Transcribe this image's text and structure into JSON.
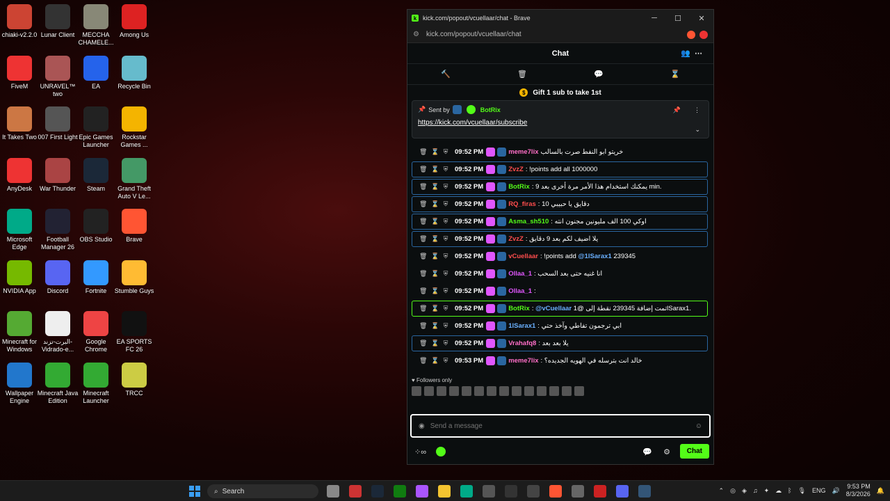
{
  "desktop_icons": [
    {
      "label": "chiaki-v2.2.0",
      "color": "#c43"
    },
    {
      "label": "Lunar Client",
      "color": "#333"
    },
    {
      "label": "MECCHA CHAMELE...",
      "color": "#887"
    },
    {
      "label": "Among Us",
      "color": "#d22"
    },
    {
      "label": "FiveM",
      "color": "#e33"
    },
    {
      "label": "UNRAVEL™ two",
      "color": "#a55"
    },
    {
      "label": "EA",
      "color": "#2563eb"
    },
    {
      "label": "Recycle Bin",
      "color": "#6bc"
    },
    {
      "label": "It Takes Two",
      "color": "#c74"
    },
    {
      "label": "007 First Light",
      "color": "#555"
    },
    {
      "label": "Epic Games Launcher",
      "color": "#222"
    },
    {
      "label": "Rockstar Games ...",
      "color": "#f4b400"
    },
    {
      "label": "AnyDesk",
      "color": "#e33"
    },
    {
      "label": "War Thunder",
      "color": "#a44"
    },
    {
      "label": "Steam",
      "color": "#1b2838"
    },
    {
      "label": "Grand Theft Auto V Le...",
      "color": "#496"
    },
    {
      "label": "Microsoft Edge",
      "color": "#0a8"
    },
    {
      "label": "Football Manager 26",
      "color": "#223"
    },
    {
      "label": "OBS Studio",
      "color": "#222"
    },
    {
      "label": "Brave",
      "color": "#f53"
    },
    {
      "label": "NVIDIA App",
      "color": "#76b900"
    },
    {
      "label": "Discord",
      "color": "#5865f2"
    },
    {
      "label": "Fortnite",
      "color": "#39f"
    },
    {
      "label": "Stumble Guys",
      "color": "#fb3"
    },
    {
      "label": "Minecraft for Windows",
      "color": "#5a3"
    },
    {
      "label": "البرت-تزند-Vidrado-e...",
      "color": "#eee"
    },
    {
      "label": "Google Chrome",
      "color": "#e44"
    },
    {
      "label": "EA SPORTS FC 26",
      "color": "#111"
    },
    {
      "label": "Wallpaper Engine",
      "color": "#27c"
    },
    {
      "label": "Minecraft Java Edition",
      "color": "#3a3"
    },
    {
      "label": "Minecraft Launcher",
      "color": "#3a3"
    },
    {
      "label": "TRCC",
      "color": "#cc4"
    }
  ],
  "window": {
    "title": "kick.com/popout/vcuellaar/chat - Brave",
    "url": "kick.com/popout/vcuellaar/chat",
    "chat_title": "Chat",
    "gift_text": "Gift 1 sub to take 1st",
    "pinned": {
      "sent_by": "Sent by",
      "sender": "BotRix",
      "link": "https://kick.com/vcuellaar/subscribe"
    },
    "followers_only": "Followers only",
    "input_placeholder": "Send a message",
    "chat_button": "Chat"
  },
  "messages": [
    {
      "time": "09:52 PM",
      "user": "meme7lix",
      "color": "#ff6ec7",
      "text": "خريتو ابو النفط صرت بالسالب",
      "hl": ""
    },
    {
      "time": "09:52 PM",
      "user": "ZvzZ",
      "color": "#ff4d4d",
      "text": ": !points add all 1000000",
      "hl": "hl"
    },
    {
      "time": "09:52 PM",
      "user": "BotRix",
      "color": "#53fc18",
      "text": ": يمكنك استخدام هذا الأمر مرة أخرى بعد 9 min.",
      "hl": "hl"
    },
    {
      "time": "09:52 PM",
      "user": "RQ_firas",
      "color": "#ff4d4d",
      "text": ": دقايق يا حبيبي 10",
      "hl": "hl"
    },
    {
      "time": "09:52 PM",
      "user": "Asma_sh510",
      "color": "#53fc18",
      "text": ": اوكي 100 الف مليونين مجنون انته",
      "hl": "hl"
    },
    {
      "time": "09:52 PM",
      "user": "ZvzZ",
      "color": "#ff4d4d",
      "text": ": يلا اضيف لكم بعد 9 دقايق",
      "hl": "hl"
    },
    {
      "time": "09:52 PM",
      "user": "vCuellaar",
      "color": "#ff4d4d",
      "text": ": !points add",
      "mention": "@1lSarax1",
      "tail": "239345",
      "hl": ""
    },
    {
      "time": "09:52 PM",
      "user": "Ollaa_1",
      "color": "#e056fd",
      "text": ": انا غنيه حتى بعد السحب",
      "hl": ""
    },
    {
      "time": "09:52 PM",
      "user": "Ollaa_1",
      "color": "#e056fd",
      "text": ":",
      "hl": ""
    },
    {
      "time": "09:52 PM",
      "user": "BotRix",
      "color": "#53fc18",
      "text": ":",
      "mention": "@vCuellaar",
      "tail": "تمت إضافة 239345 نقطة إلى @1lSarax1.",
      "hl": "hlg"
    },
    {
      "time": "09:52 PM",
      "user": "1lSarax1",
      "color": "#6ab0ff",
      "text": ": ابي ترجمون تفاطي وآخذ حتي",
      "hl": ""
    },
    {
      "time": "09:52 PM",
      "user": "Vrahafq8",
      "color": "#ff6ec7",
      "text": ": يلا بعد بعد",
      "hl": "hl"
    },
    {
      "time": "09:53 PM",
      "user": "meme7lix",
      "color": "#ff6ec7",
      "text": ": خالد انت بترسله في الهويه الجديده؟",
      "hl": ""
    }
  ],
  "taskbar": {
    "search": "Search",
    "lang": "ENG",
    "time": "9:53 PM",
    "date": "8/3/2026"
  }
}
